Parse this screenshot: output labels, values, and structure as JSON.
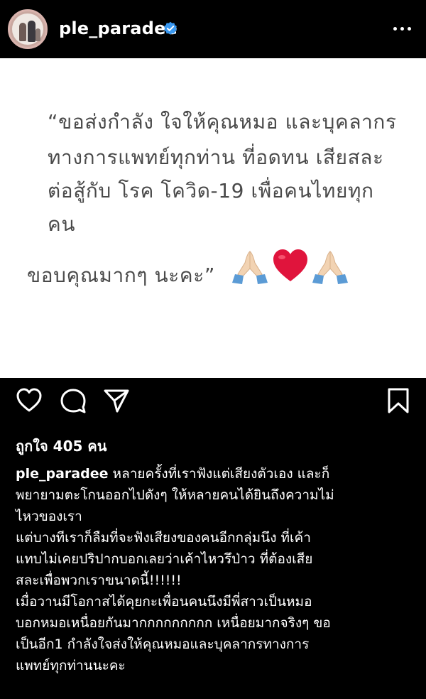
{
  "header": {
    "username": "ple_paradee",
    "verified_icon": "verified-badge-icon",
    "more_icon": "more-options-icon"
  },
  "post_image": {
    "background": "#ffffff",
    "text_color": "#4a4a4a",
    "lines": [
      "“ขอส่งกำลัง ใจให้คุณหมอ และบุคลากร",
      "ทางการแพทย์ทุกท่าน ที่อดทน เสียสละ",
      "ต่อสู้กับ โรค โควิด-19 เพื่อคนไทยทุก",
      "คน",
      "ขอบคุณมากๆ นะคะ”"
    ],
    "emojis": [
      "praying-hands-emoji",
      "red-heart-emoji",
      "praying-hands-emoji"
    ]
  },
  "actions": {
    "like_icon": "heart-icon",
    "comment_icon": "comment-icon",
    "share_icon": "share-icon",
    "save_icon": "bookmark-icon"
  },
  "likes_text": "ถูกใจ 405 คน",
  "caption": {
    "username": "ple_paradee",
    "first_line_rest": " หลายครั้งที่เราฟังแต่เสียงตัวเอง และก็",
    "lines": [
      "พยายามตะโกนออกไปดังๆ ให้หลายคนได้ยินถึงความไม่",
      "ไหวของเรา",
      "แต่บางทีเราก็ลืมที่จะฟังเสียงของคนอีกกลุ่มนึง ที่เค้า",
      "แทบไม่เคยปริปากบอกเลยว่าเค้าไหวรึป่าว ที่ต้องเสีย",
      "สละเพื่อพวกเราขนาดนี้!!!!!!",
      "เมื่อวานมีโอกาสได้คุยกะเพื่อนคนนึงมีพี่สาวเป็นหมอ",
      "บอกหมอเหนื่อยกันมากกกกกกกกก เหนื่อยมากจริงๆ ขอ",
      "เป็นอีก1 กำลังใจส่งให้คุณหมอและบุคลากรทางการ",
      "แพทย์ทุกท่านนะคะ"
    ]
  },
  "colors": {
    "background": "#000000",
    "text": "#ffffff",
    "verified": "#3897f0",
    "heart": "#e0143c",
    "skin": "#f2d3b3",
    "sleeve": "#5b9bd5"
  }
}
